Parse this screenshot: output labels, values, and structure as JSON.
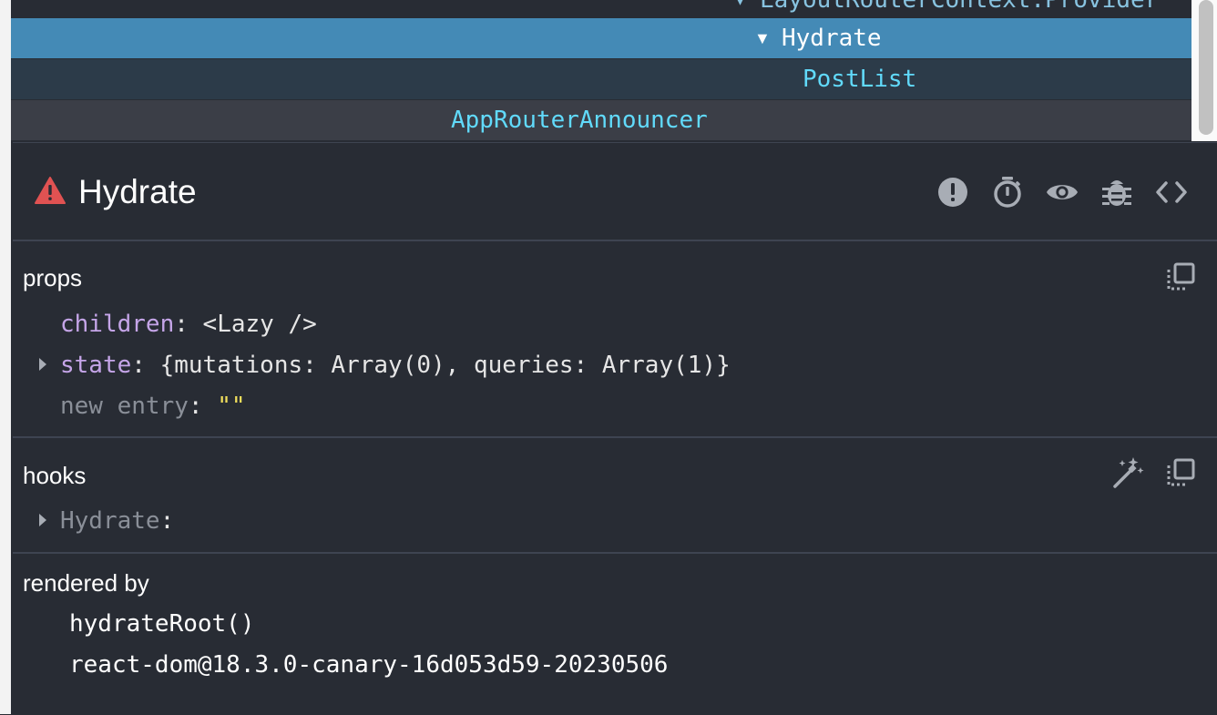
{
  "tree": {
    "rows": [
      {
        "name": "LayoutRouterContext.Provider"
      },
      {
        "name": "Hydrate"
      },
      {
        "name": "PostList"
      },
      {
        "name": "AppRouterAnnouncer"
      }
    ]
  },
  "inspector": {
    "title": "Hydrate",
    "props": {
      "title": "props",
      "children_key": "children",
      "children_value": "<Lazy />",
      "state_key": "state",
      "state_value": "{mutations: Array(0), queries: Array(1)}",
      "new_entry_key": "new entry",
      "new_entry_value": "\"\""
    },
    "hooks": {
      "title": "hooks",
      "item_key": "Hydrate"
    },
    "rendered_by": {
      "title": "rendered by",
      "items": [
        "hydrateRoot()",
        "react-dom@18.3.0-canary-16d053d59-20230506"
      ]
    }
  },
  "colors": {
    "background": "#282c34",
    "selected_row": "#448ab6",
    "component_name": "#61dafb",
    "prop_key": "#c5a5e8",
    "string_value": "#f2e05c",
    "warning": "#e05252"
  },
  "icons": [
    "warning-icon",
    "error-icon",
    "stopwatch-icon",
    "eye-icon",
    "bug-icon",
    "code-icon",
    "copy-icon",
    "magic-wand-icon",
    "expand-triangle-icon"
  ]
}
